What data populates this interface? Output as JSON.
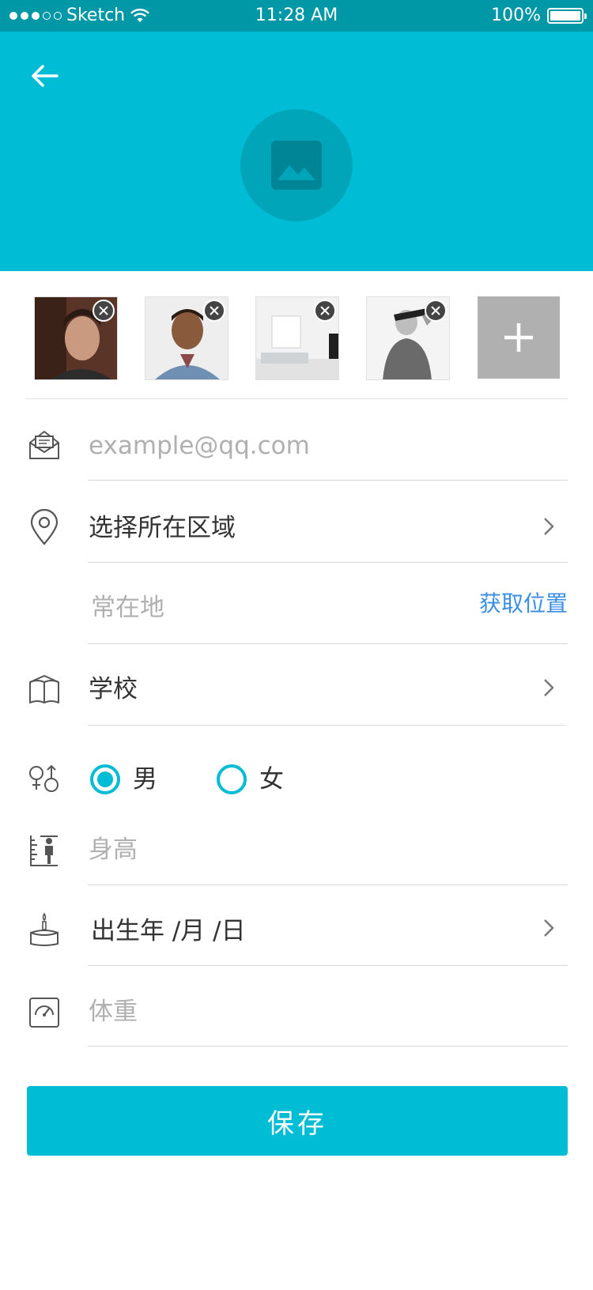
{
  "status_bar": {
    "carrier": "Sketch",
    "time": "11:28 AM",
    "battery": "100%",
    "battery_level": 1.0
  },
  "header": {
    "back_icon": "arrow-left-icon",
    "avatar_icon": "image-placeholder-icon",
    "background_color": "#00bcd4"
  },
  "photos": {
    "items": [
      {
        "description_icon": "photo-thumbnail"
      },
      {
        "description_icon": "photo-thumbnail"
      },
      {
        "description_icon": "photo-thumbnail"
      },
      {
        "description_icon": "photo-thumbnail"
      }
    ],
    "add_icon": "plus-icon"
  },
  "form": {
    "email": {
      "placeholder": "example@qq.com",
      "icon": "envelope-icon"
    },
    "region": {
      "label": "选择所在区域",
      "icon": "location-pin-icon"
    },
    "residence": {
      "placeholder": "常在地",
      "action": "获取位置"
    },
    "school": {
      "label": "学校",
      "icon": "book-icon"
    },
    "gender": {
      "icon": "gender-icon",
      "options": [
        "男",
        "女"
      ],
      "selected": "男"
    },
    "height": {
      "placeholder": "身高",
      "icon": "height-ruler-icon"
    },
    "birthday": {
      "label": "出生年 /月 /日",
      "icon": "cake-icon"
    },
    "weight": {
      "placeholder": "体重",
      "icon": "scale-icon"
    }
  },
  "save_button": {
    "label": "保存"
  },
  "colors": {
    "accent": "#00bcd4",
    "accent_dark": "#0097a7",
    "link": "#3b8ee6",
    "placeholder": "#b0b0b0"
  }
}
